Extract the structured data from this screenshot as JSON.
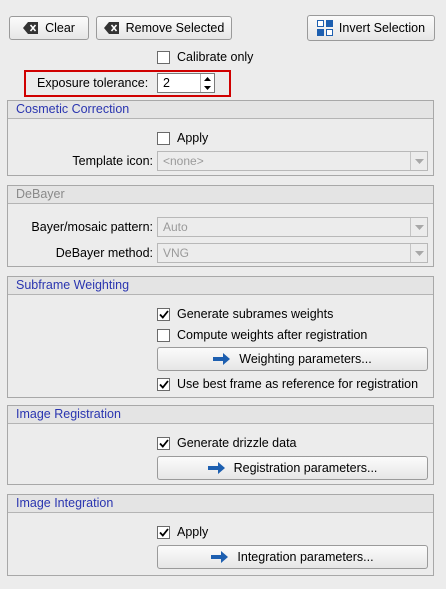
{
  "toolbar": {
    "clear_label": "Clear",
    "remove_selected_label": "Remove Selected",
    "invert_selection_label": "Invert Selection"
  },
  "calibrate_only": {
    "label": "Calibrate only",
    "checked": false
  },
  "exposure_tolerance": {
    "label": "Exposure tolerance:",
    "value": "2"
  },
  "cosmetic_correction": {
    "title": "Cosmetic Correction",
    "apply_label": "Apply",
    "apply_checked": false,
    "template_label": "Template icon:",
    "template_value": "<none>"
  },
  "debayer": {
    "title": "DeBayer",
    "pattern_label": "Bayer/mosaic pattern:",
    "pattern_value": "Auto",
    "method_label": "DeBayer method:",
    "method_value": "VNG"
  },
  "subframe_weighting": {
    "title": "Subframe Weighting",
    "generate_label": "Generate subrames weights",
    "generate_checked": true,
    "compute_label": "Compute weights after registration",
    "compute_checked": false,
    "params_label": "Weighting parameters...",
    "best_frame_label": "Use best frame as reference for registration",
    "best_frame_checked": true
  },
  "image_registration": {
    "title": "Image Registration",
    "drizzle_label": "Generate drizzle data",
    "drizzle_checked": true,
    "params_label": "Registration parameters..."
  },
  "image_integration": {
    "title": "Image Integration",
    "apply_label": "Apply",
    "apply_checked": true,
    "params_label": "Integration parameters..."
  },
  "colors": {
    "section_title": "#2a35b0",
    "highlight_box": "#d00000",
    "arrow_icon": "#1d5fb0"
  }
}
